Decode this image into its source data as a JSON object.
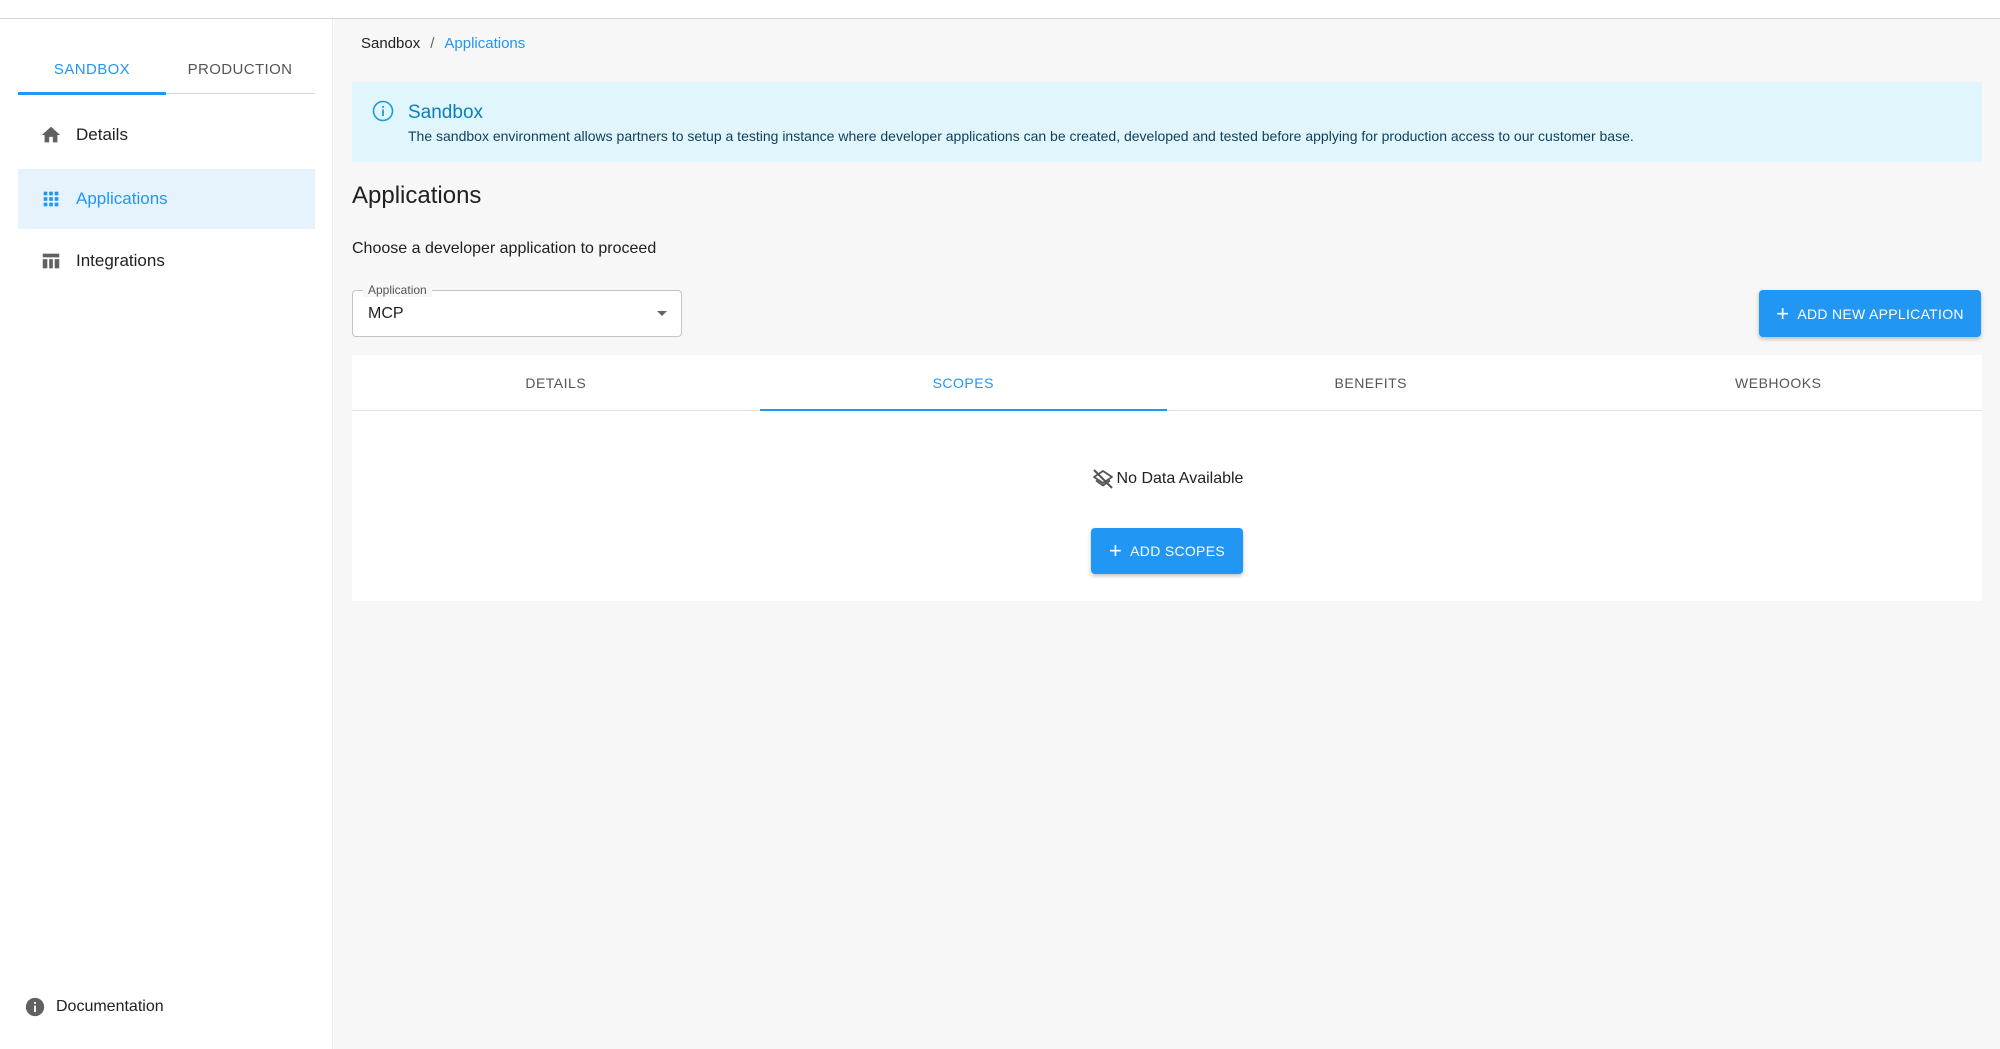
{
  "sidebar": {
    "env_tabs": [
      {
        "label": "SANDBOX",
        "active": true
      },
      {
        "label": "PRODUCTION",
        "active": false
      }
    ],
    "items": [
      {
        "label": "Details",
        "icon": "home-icon"
      },
      {
        "label": "Applications",
        "icon": "apps-grid-icon",
        "active": true
      },
      {
        "label": "Integrations",
        "icon": "table-icon"
      }
    ],
    "documentation_label": "Documentation"
  },
  "breadcrumb": {
    "root": "Sandbox",
    "separator": "/",
    "current": "Applications"
  },
  "alert": {
    "title": "Sandbox",
    "body": "The sandbox environment allows partners to setup a testing instance where developer applications can be created, developed and tested before applying for production access to our customer base."
  },
  "main": {
    "title": "Applications",
    "subtitle": "Choose a developer application to proceed",
    "application_select": {
      "label": "Application",
      "value": "MCP"
    },
    "add_application_label": "ADD NEW APPLICATION",
    "tabs": [
      {
        "label": "DETAILS"
      },
      {
        "label": "SCOPES",
        "active": true
      },
      {
        "label": "BENEFITS"
      },
      {
        "label": "WEBHOOKS"
      }
    ],
    "empty_text": "No Data Available",
    "add_scopes_label": "ADD SCOPES"
  },
  "colors": {
    "accent": "#2196f3",
    "alert_bg": "#e1f5fc",
    "alert_title": "#0b7fb8",
    "active_nav_bg": "#e6f3fd"
  }
}
